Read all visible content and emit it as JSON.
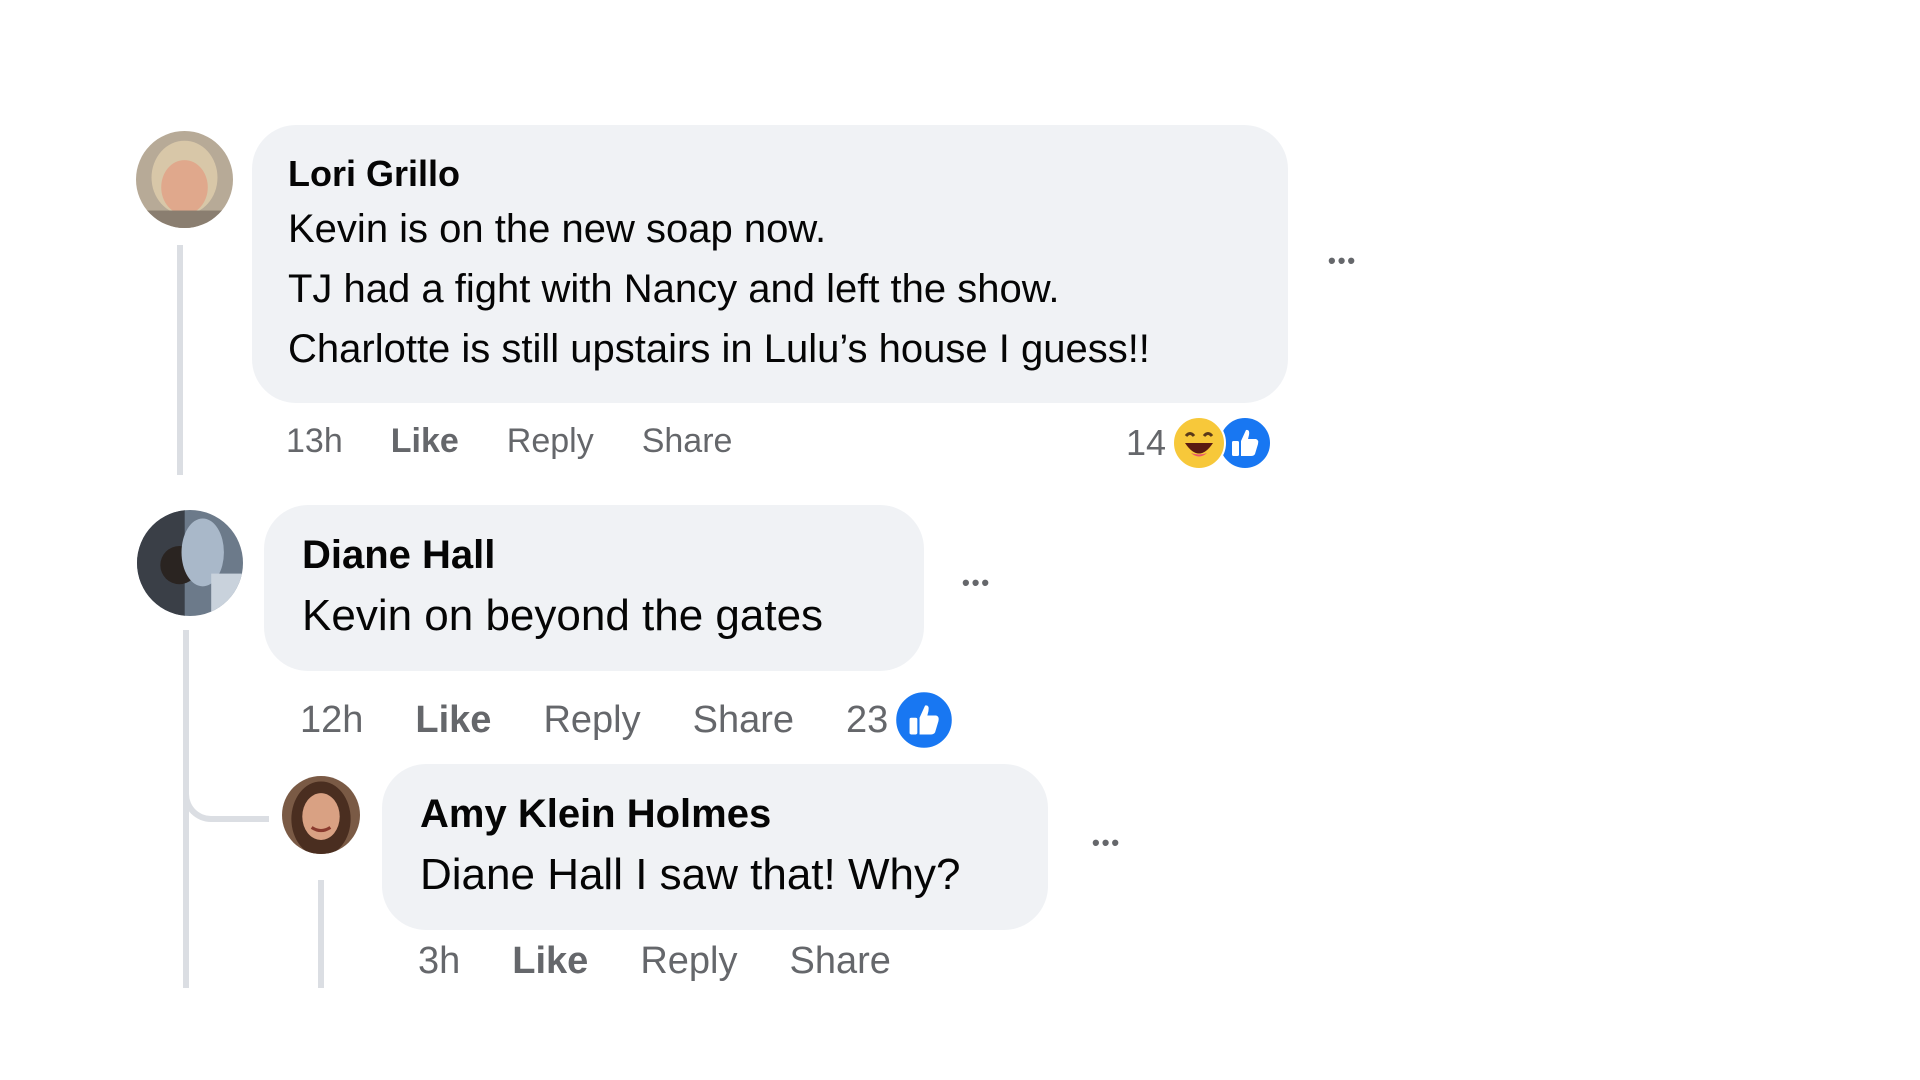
{
  "comments": [
    {
      "author": "Lori Grillo",
      "lines": [
        "Kevin is on the new soap now.",
        "TJ had a fight with Nancy and left the show.",
        "Charlotte is still upstairs in Lulu’s house I guess!!"
      ],
      "time": "13h",
      "like_label": "Like",
      "reply_label": "Reply",
      "share_label": "Share",
      "reaction_count": "14",
      "reactions": [
        "haha-icon",
        "like-icon"
      ],
      "more_label": "•••"
    },
    {
      "author": "Diane Hall",
      "lines": [
        "Kevin on beyond the gates"
      ],
      "time": "12h",
      "like_label": "Like",
      "reply_label": "Reply",
      "share_label": "Share",
      "reaction_count": "23",
      "reactions": [
        "like-icon"
      ],
      "more_label": "•••"
    },
    {
      "author": "Amy Klein Holmes",
      "lines": [
        "Diane Hall I saw that! Why?"
      ],
      "time": "3h",
      "like_label": "Like",
      "reply_label": "Reply",
      "share_label": "Share",
      "more_label": "•••"
    }
  ],
  "colors": {
    "bubble": "#f0f2f5",
    "secondary_text": "#65676b",
    "like_blue": "#1877f2",
    "thread_line": "#dbdee3"
  }
}
